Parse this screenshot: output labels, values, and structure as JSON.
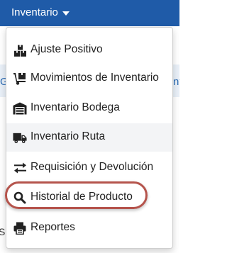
{
  "navbar": {
    "menu_label": "Inventario"
  },
  "background": {
    "left_fragment": "G",
    "right_fragment": "nt",
    "bottom_fragment": "S"
  },
  "dropdown": {
    "items": [
      {
        "label": "Ajuste Positivo",
        "icon": "boxes-icon"
      },
      {
        "label": "Movimientos de Inventario",
        "icon": "dolly-icon"
      },
      {
        "label": "Inventario Bodega",
        "icon": "warehouse-icon"
      },
      {
        "label": "Inventario Ruta",
        "icon": "truck-icon"
      },
      {
        "label": "Requisición y Devolución",
        "icon": "exchange-icon"
      },
      {
        "label": "Historial de Producto",
        "icon": "search-icon"
      },
      {
        "label": "Reportes",
        "icon": "print-icon"
      }
    ]
  },
  "colors": {
    "navbar": "#1f5ba8",
    "highlight_ring": "#b5544c"
  }
}
